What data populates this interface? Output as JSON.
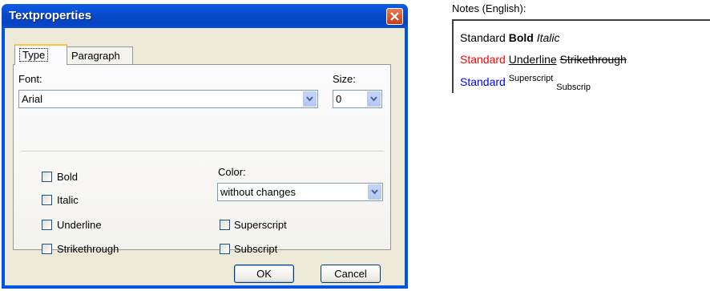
{
  "dialog": {
    "title": "Textproperties",
    "tabs": [
      {
        "label": "Type",
        "active": true
      },
      {
        "label": "Paragraph",
        "active": false
      }
    ],
    "font": {
      "label": "Font:",
      "value": "Arial"
    },
    "size": {
      "label": "Size:",
      "value": "0"
    },
    "color": {
      "label": "Color:",
      "value": "without changes"
    },
    "checkboxes_left": [
      {
        "label": "Bold",
        "checked": false
      },
      {
        "label": "Italic",
        "checked": false
      },
      {
        "label": "Underline",
        "checked": false
      },
      {
        "label": "Strikethrough",
        "checked": false
      }
    ],
    "checkboxes_right": [
      {
        "label": "Superscript",
        "checked": false
      },
      {
        "label": "Subscript",
        "checked": false
      }
    ],
    "buttons": {
      "ok": "OK",
      "cancel": "Cancel"
    }
  },
  "notes": {
    "label": "Notes (English):",
    "line1": {
      "standard": "Standard",
      "bold": "Bold",
      "italic": "Italic"
    },
    "line2": {
      "standard": "Standard",
      "underline": "Underline",
      "strike": "Strikethrough",
      "color": "#ff0000"
    },
    "line3": {
      "standard": "Standard",
      "superscript": "Superscript",
      "subscript": "Subscrip",
      "color": "#0000ff"
    }
  },
  "colors": {
    "titlebar": "#0054e3",
    "dialog_bg": "#ece9d8",
    "close_button": "#e0542a"
  }
}
